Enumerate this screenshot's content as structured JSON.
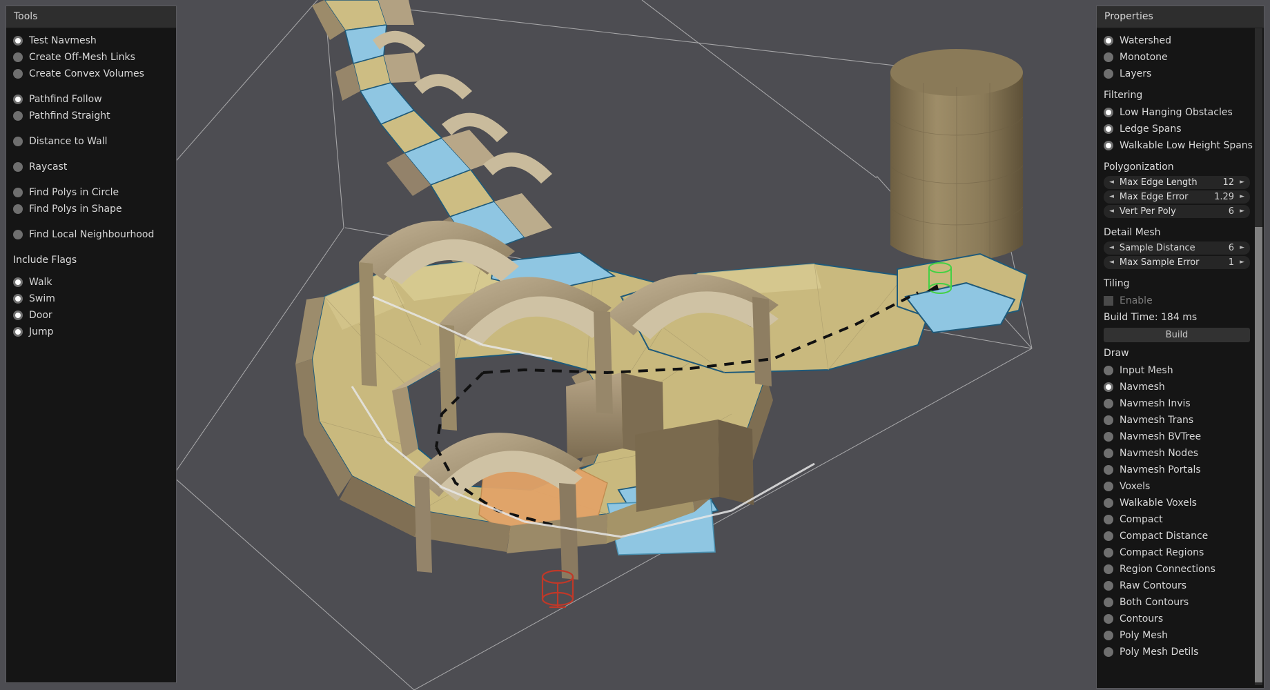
{
  "app": {
    "background_color": "#4d4d52"
  },
  "tools": {
    "title": "Tools",
    "modes": [
      {
        "label": "Test Navmesh",
        "selected": true
      },
      {
        "label": "Create Off-Mesh Links",
        "selected": false
      },
      {
        "label": "Create Convex Volumes",
        "selected": false
      }
    ],
    "pathfind": [
      {
        "label": "Pathfind Follow",
        "selected": true
      },
      {
        "label": "Pathfind Straight",
        "selected": false
      }
    ],
    "distance": [
      {
        "label": "Distance to Wall",
        "selected": false
      }
    ],
    "raycast": [
      {
        "label": "Raycast",
        "selected": false
      }
    ],
    "find_polys": [
      {
        "label": "Find Polys in Circle",
        "selected": false
      },
      {
        "label": "Find Polys in Shape",
        "selected": false
      }
    ],
    "neighbourhood": [
      {
        "label": "Find Local Neighbourhood",
        "selected": false
      }
    ],
    "include_flags_title": "Include Flags",
    "include_flags": [
      {
        "label": "Walk",
        "selected": true
      },
      {
        "label": "Swim",
        "selected": true
      },
      {
        "label": "Door",
        "selected": true
      },
      {
        "label": "Jump",
        "selected": true
      }
    ]
  },
  "properties": {
    "title": "Properties",
    "partitioning": [
      {
        "label": "Watershed",
        "selected": true
      },
      {
        "label": "Monotone",
        "selected": false
      },
      {
        "label": "Layers",
        "selected": false
      }
    ],
    "filtering_title": "Filtering",
    "filtering": [
      {
        "label": "Low Hanging Obstacles",
        "selected": true
      },
      {
        "label": "Ledge Spans",
        "selected": true
      },
      {
        "label": "Walkable Low Height Spans",
        "selected": true
      }
    ],
    "polygonization_title": "Polygonization",
    "polygonization": [
      {
        "label": "Max Edge Length",
        "value": "12"
      },
      {
        "label": "Max Edge Error",
        "value": "1.29"
      },
      {
        "label": "Vert Per Poly",
        "value": "6"
      }
    ],
    "detail_mesh_title": "Detail Mesh",
    "detail_mesh": [
      {
        "label": "Sample Distance",
        "value": "6"
      },
      {
        "label": "Max Sample Error",
        "value": "1"
      }
    ],
    "tiling_title": "Tiling",
    "tiling_enable": {
      "label": "Enable",
      "checked": false
    },
    "build_time": "Build Time: 184 ms",
    "build_button": "Build",
    "draw_title": "Draw",
    "draw": [
      {
        "label": "Input Mesh",
        "selected": false
      },
      {
        "label": "Navmesh",
        "selected": true
      },
      {
        "label": "Navmesh Invis",
        "selected": false
      },
      {
        "label": "Navmesh Trans",
        "selected": false
      },
      {
        "label": "Navmesh BVTree",
        "selected": false
      },
      {
        "label": "Navmesh Nodes",
        "selected": false
      },
      {
        "label": "Navmesh Portals",
        "selected": false
      },
      {
        "label": "Voxels",
        "selected": false
      },
      {
        "label": "Walkable Voxels",
        "selected": false
      },
      {
        "label": "Compact",
        "selected": false
      },
      {
        "label": "Compact Distance",
        "selected": false
      },
      {
        "label": "Compact Regions",
        "selected": false
      },
      {
        "label": "Region Connections",
        "selected": false
      },
      {
        "label": "Raw Contours",
        "selected": false
      },
      {
        "label": "Both Contours",
        "selected": false
      },
      {
        "label": "Contours",
        "selected": false
      },
      {
        "label": "Poly Mesh",
        "selected": false
      },
      {
        "label": "Poly Mesh Detils",
        "selected": false
      }
    ],
    "arrow_left": "◄",
    "arrow_right": "►"
  },
  "viewport": {
    "description": "3D navmesh preview of a curved multi-level architecture scene",
    "colors": {
      "background": "#4d4d52",
      "navmesh_walk": "#c8b77a",
      "navmesh_walk_alt": "#d5c88e",
      "navmesh_water": "#7fc1e0",
      "navmesh_selected": "#e0a068",
      "wall_light": "#b9a88a",
      "wall_mid": "#9d8b6c",
      "wall_dark": "#7e6e52",
      "edge_blue": "#1f5a7a",
      "path_line": "#111111",
      "agent_marker": "#c03828",
      "target_marker": "#44d044",
      "bounds_line": "#e8e8e8"
    }
  }
}
